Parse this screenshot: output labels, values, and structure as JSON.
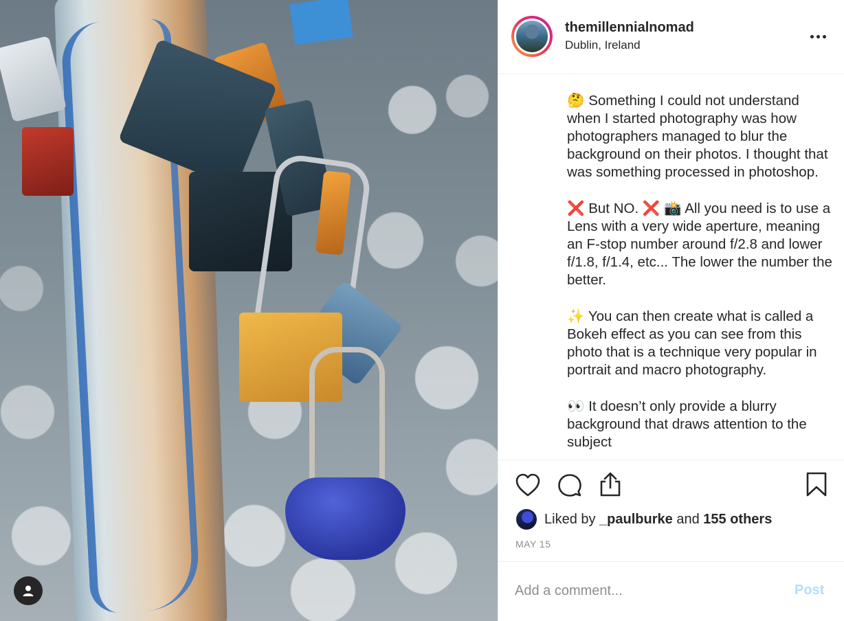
{
  "post": {
    "username": "themillennialnomad",
    "location": "Dublin, Ireland",
    "more_icon": "more-horizontal-icon"
  },
  "caption": {
    "paragraphs": [
      {
        "emoji": "🤔",
        "emoji_icon": "thinking-face-emoji",
        "text": "Something I could not understand when I started photography was how photographers managed to blur the background on their photos. I thought that was something processed in photoshop."
      },
      {
        "emoji_a": "❌",
        "text_a": "But NO.",
        "emoji_b": "❌",
        "emoji_c": "📸",
        "text_b": "All you need is to use a Lens with a very wide aperture, meaning an F-stop number around f/2.8 and lower f/1.8, f/1.4, etc... The lower the number the better."
      },
      {
        "emoji": "✨",
        "text": "You can then create what is called a Bokeh effect as you can see from this photo that is a technique very popular in portrait and macro photography."
      },
      {
        "emoji": "👀",
        "text": "It doesn’t only provide a blurry background that draws attention to the subject"
      }
    ]
  },
  "actions": {
    "like_icon": "heart-icon",
    "comment_icon": "comment-bubble-icon",
    "share_icon": "share-upload-icon",
    "save_icon": "bookmark-icon"
  },
  "likes": {
    "prefix": "Liked by",
    "user": "_paulburke",
    "middle": "and",
    "others": "155 others"
  },
  "date": "MAY 15",
  "comment": {
    "placeholder": "Add a comment...",
    "post_label": "Post"
  },
  "colors": {
    "text": "#262626",
    "muted": "#8e8e8e",
    "post_disabled": "#b2dffc",
    "divider": "#efefef"
  }
}
